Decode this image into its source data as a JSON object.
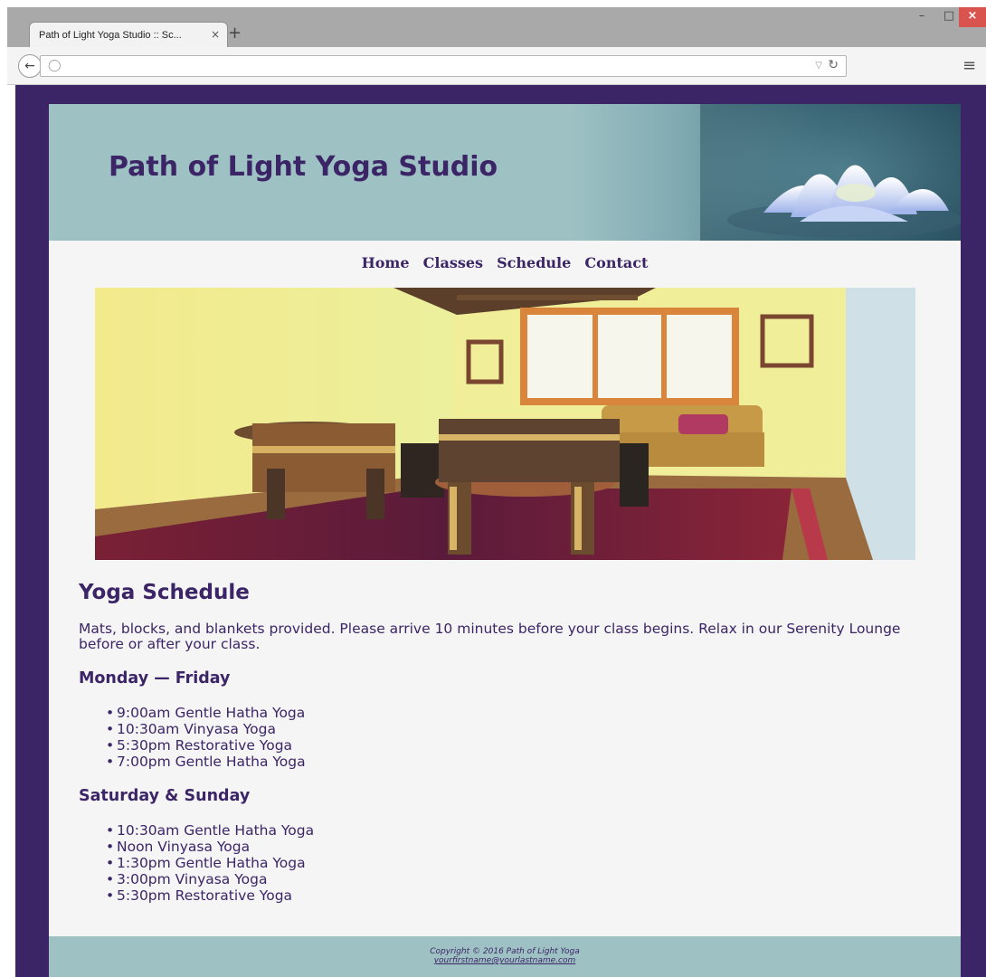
{
  "browser": {
    "tab_title": "Path of Light Yoga Studio :: Sc...",
    "tab_close": "×",
    "new_tab": "+",
    "url": "",
    "window_controls": {
      "minimize": "–",
      "maximize": "□",
      "close": "×"
    }
  },
  "page": {
    "site_title": "Path of Light Yoga Studio",
    "nav": [
      "Home",
      "Classes",
      "Schedule",
      "Contact"
    ],
    "heading": "Yoga Schedule",
    "intro": "Mats, blocks, and blankets provided. Please arrive 10 minutes before your class begins. Relax in our Serenity Lounge before or after your class.",
    "sections": [
      {
        "title": "Monday — Friday",
        "classes": [
          "9:00am Gentle Hatha Yoga",
          "10:30am Vinyasa Yoga",
          "5:30pm Restorative Yoga",
          "7:00pm Gentle Hatha Yoga"
        ]
      },
      {
        "title": "Saturday & Sunday",
        "classes": [
          "10:30am Gentle Hatha Yoga",
          "Noon Vinyasa Yoga",
          "1:30pm Gentle Hatha Yoga",
          "3:00pm Vinyasa Yoga",
          "5:30pm Restorative Yoga"
        ]
      }
    ],
    "footer": {
      "copyright": "Copyright © 2016 Path of Light Yoga",
      "email": "yourfirstname@yourlastname.com"
    }
  },
  "colors": {
    "brand_purple": "#3c2566",
    "header_teal": "#9ec2c4",
    "page_background": "#f5f5f5"
  }
}
